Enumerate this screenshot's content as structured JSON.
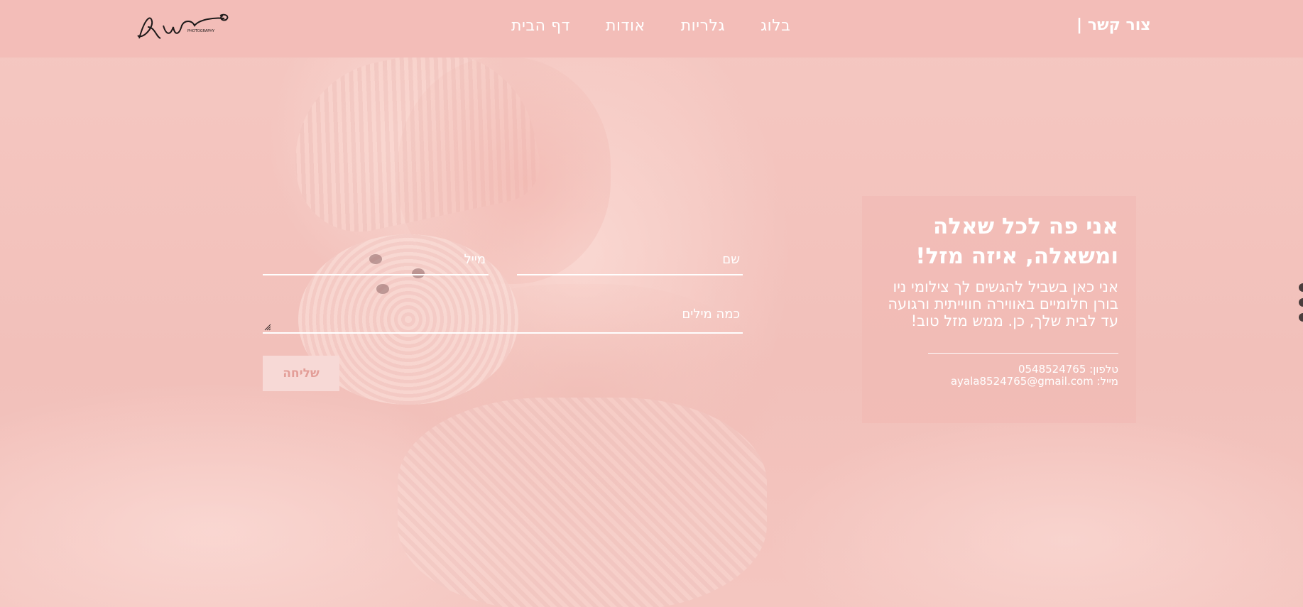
{
  "header": {
    "contact_link": "צור קשר |",
    "nav": [
      {
        "label": "דף הבית"
      },
      {
        "label": "אודות"
      },
      {
        "label": "גלריות"
      },
      {
        "label": "בלוג"
      }
    ],
    "logo_text": "PHOTOGRAPHY"
  },
  "form": {
    "name_placeholder": "שם",
    "email_placeholder": "מייל",
    "message_placeholder": "כמה מילים",
    "submit_label": "שליחה"
  },
  "card": {
    "title_line1": "אני פה לכל שאלה",
    "title_line2": "ומשאלה, איזה מזל!",
    "text_line1": "אני כאן בשביל להגשים לך צילומי ניו",
    "text_line2": "בורן חלומיים באווירה חווייתית ורגועה",
    "text_line3": "עד לבית שלך, כן. ממש מזל טוב!",
    "phone_line": "טלפון: 0548524765",
    "email_line": "מייל: ayala8524765@gmail.com"
  },
  "colors": {
    "background": "#f3c4bf",
    "header": "#f3bdb8",
    "text": "#ffffff",
    "button_bg": "#f7d9d6",
    "button_text": "#e39e98"
  }
}
